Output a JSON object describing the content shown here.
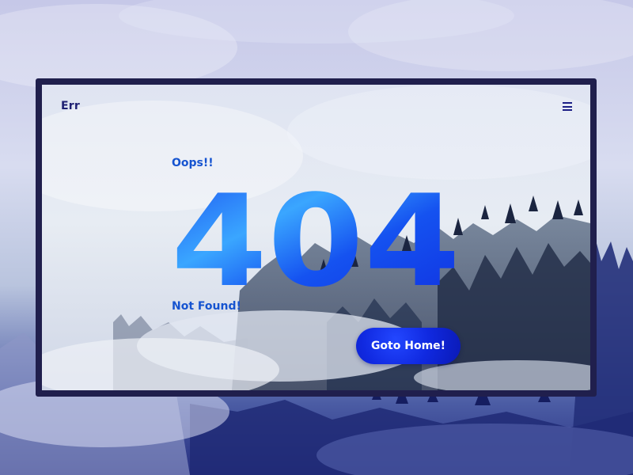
{
  "header": {
    "brand": "Err",
    "menu_icon": "hamburger-menu-icon"
  },
  "content": {
    "eyebrow": "Oops!!",
    "error_code": "404",
    "message": "Not Found!",
    "home_button_label": "Goto Home!"
  },
  "colors": {
    "frame_border": "#201f4d",
    "accent_text": "#1654d0",
    "brand_text": "#1e1f72",
    "button": "#1029e0",
    "code_light": "#3aa6ff",
    "code_dark": "#0f2fe0"
  }
}
